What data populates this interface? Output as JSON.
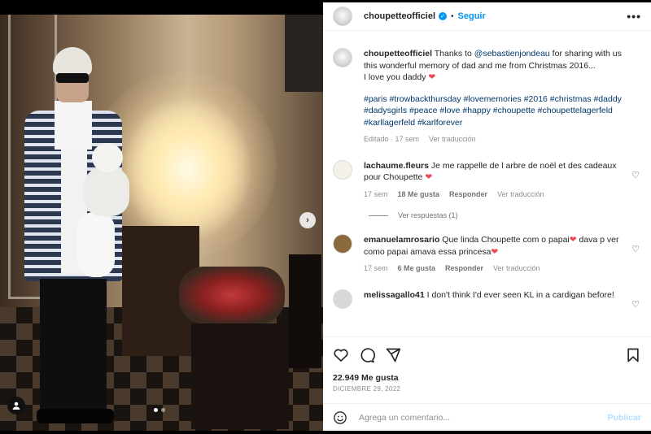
{
  "post": {
    "username": "choupetteofficiel",
    "follow_label": "Seguir",
    "more_label": "•••",
    "carousel_next": "›",
    "caption": {
      "lead": "Thanks to ",
      "mention": "@sebastienjondeau",
      "rest": " for sharing with us this wonderful memory of dad and me from Christmas 2016...",
      "line2": "I love you daddy ",
      "heart": "❤",
      "hashtags": "#paris #trowbackthursday #lovememories #2016 #christmas #daddy #dadysgirls #peace #love #happy #choupette #choupettelagerfeld #karllagerfeld #karlforever",
      "edited": "Editado · 17 sem",
      "translate": "Ver traducción"
    },
    "comments": [
      {
        "username": "lachaume.fleurs",
        "text": "Je me rappelle de l arbre de noël et des cadeaux pour Choupette ",
        "heart": "❤",
        "time": "17 sem",
        "likes": "18 Me gusta",
        "reply": "Responder",
        "translate": "Ver traducción",
        "view_replies": "Ver respuestas (1)",
        "avatar_color": "#f4f1ea"
      },
      {
        "username": "emanuelamrosario",
        "text": "Que linda Choupette com o papai",
        "heart": "❤",
        "text2": " dava p ver como papai amava essa princesa",
        "heart2": "❤",
        "time": "17 sem",
        "likes": "6 Me gusta",
        "reply": "Responder",
        "translate": "Ver traducción",
        "avatar_color": "#8a6a3a"
      },
      {
        "username": "melissagallo41",
        "text": "I don't think I'd ever seen KL in a cardigan before!",
        "avatar_color": "#d8d8d8"
      }
    ],
    "likes": "22.949 Me gusta",
    "date": "DICIEMBRE 29, 2022",
    "comment_placeholder": "Agrega un comentario...",
    "publish_label": "Publicar",
    "carousel_total": 2,
    "carousel_active": 1
  },
  "colors": {
    "accent": "#0095f6",
    "link": "#00376b",
    "heart": "#ed4956",
    "muted": "#8e8e8e"
  },
  "icons": [
    "like-icon",
    "comment-icon",
    "share-icon",
    "bookmark-icon",
    "emoji-icon",
    "user-tag-icon",
    "chevron-right-icon",
    "verified-badge-icon",
    "more-options-icon",
    "comment-like-icon"
  ]
}
